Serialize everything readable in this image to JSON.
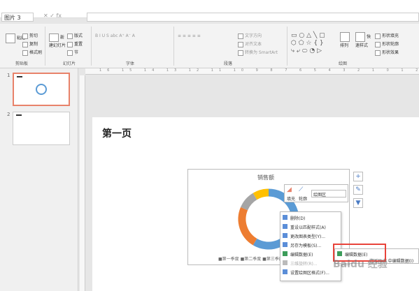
{
  "namebar": {
    "namebox": "图片 3",
    "fx_symbols": "✕ ✓ fx"
  },
  "ribbon": {
    "groups": [
      {
        "label": "剪贴板"
      },
      {
        "label": "幻灯片"
      },
      {
        "label": "字体"
      },
      {
        "label": "段落"
      },
      {
        "label": "绘图"
      }
    ],
    "buttons": {
      "paste": "粘贴",
      "cut": "剪切",
      "copy": "复制",
      "format": "格式刷",
      "new_slide": "新建幻灯片",
      "layout": "版式",
      "reset": "重置",
      "section": "节",
      "text_direction": "文字方向",
      "align_text": "对齐文本",
      "smartart": "转换为 SmartArt",
      "arrange": "排列",
      "quick_styles": "快速样式",
      "shape_fill": "形状填充",
      "shape_outline": "形状轮廓",
      "shape_effects": "形状效果"
    }
  },
  "slides": [
    {
      "number": "1"
    },
    {
      "number": "2"
    }
  ],
  "ruler_text": "16 15 14 13 12 11 10 9 8 7 6 5 4 3 2 1 0 1 2 3 4 5 6 7 8 9 10 11 12 13 14 15 16",
  "page": {
    "title": "第一页"
  },
  "chart": {
    "title": "销售额",
    "legend": "■第一季度  ■第二季度  ■第三季度  ■第四季度"
  },
  "chart_data": {
    "type": "pie",
    "title": "销售额",
    "categories": [
      "第一季度",
      "第二季度",
      "第三季度",
      "第四季度"
    ],
    "values": [
      8.2,
      3.2,
      1.4,
      1.2
    ],
    "colors": [
      "#5b9bd5",
      "#ed7d31",
      "#a5a5a5",
      "#ffc000"
    ]
  },
  "minitoolbar": {
    "fill": "填充",
    "outline": "轮廓",
    "dropdown": "绘图区"
  },
  "context_menu": {
    "items": [
      "删除(D)",
      "重设以匹配样式(A)",
      "更改图表类型(Y)...",
      "另存为模板(S)...",
      "编辑数据(E)",
      "三维旋转(R)...",
      "设置绘图区格式(F)..."
    ]
  },
  "submenu": {
    "items": [
      "编辑数据(E)",
      "在 Excel 中编辑数据(I)"
    ]
  },
  "watermark": "Baidu 经验",
  "colors": {
    "accent": "#e8826a",
    "highlight": "#e8433a",
    "chart_blue": "#5b9bd5"
  }
}
